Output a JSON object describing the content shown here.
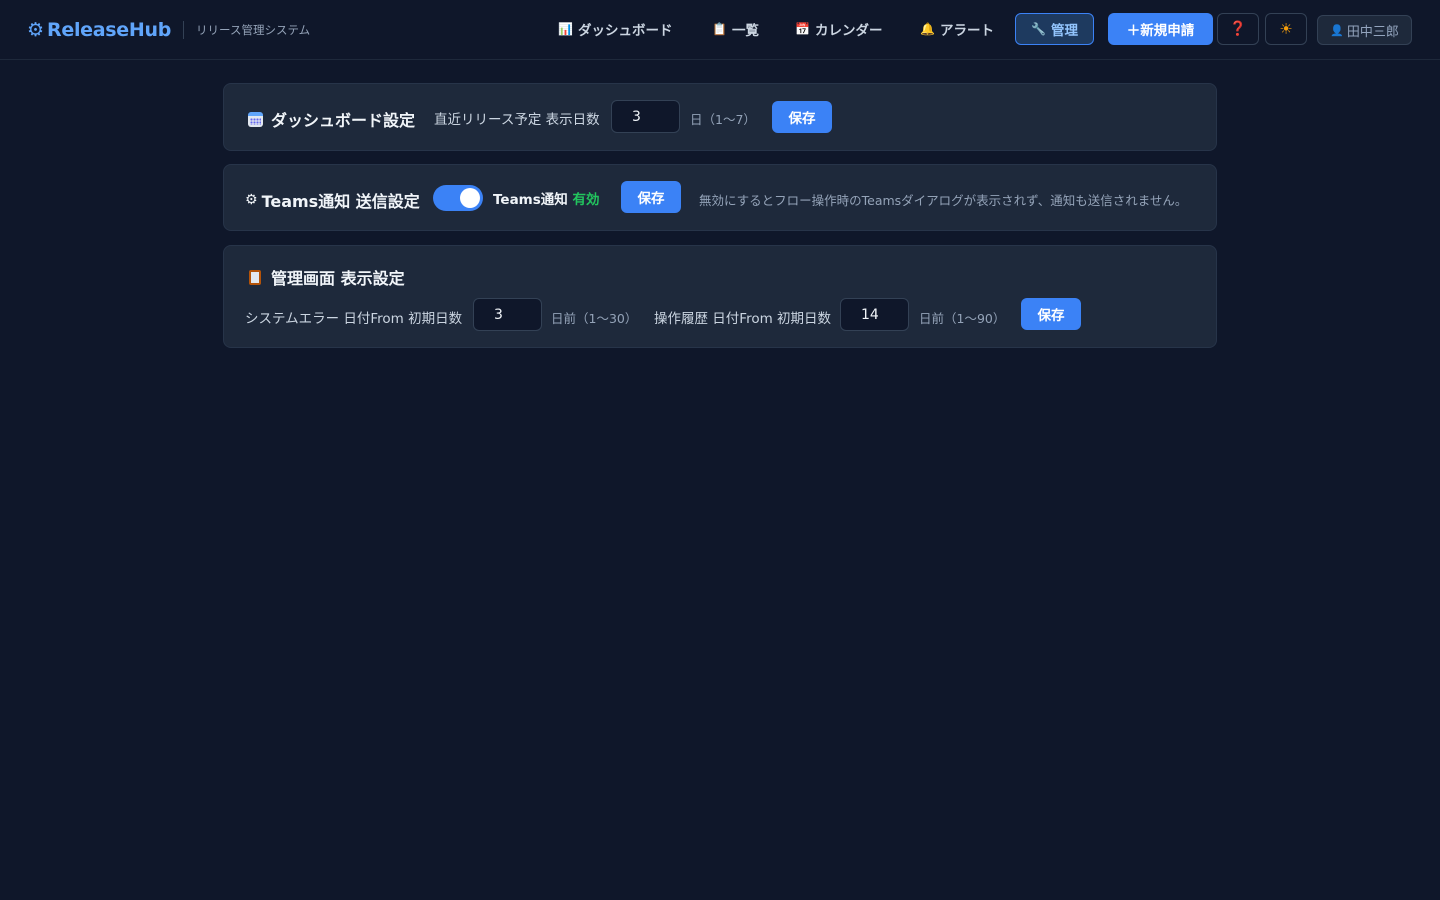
{
  "header": {
    "brand_icon": "⚙",
    "brand_name": "ReleaseHub",
    "brand_sub": "リリース管理システム",
    "nav": [
      {
        "icon": "📊",
        "label": "ダッシュボード"
      },
      {
        "icon": "📋",
        "label": "一覧"
      },
      {
        "icon": "📅",
        "label": "カレンダー"
      },
      {
        "icon": "🔔",
        "label": "アラート"
      },
      {
        "icon": "🔧",
        "label": "管理"
      }
    ],
    "new_button": "＋新規申請",
    "help_icon": "❓",
    "theme_icon": "☀",
    "user_icon": "👤",
    "user_name": "田中三郎"
  },
  "dashboard_settings": {
    "title": "ダッシュボード設定",
    "label": "直近リリース予定 表示日数",
    "value": "3",
    "hint": "日（1〜7）",
    "save": "保存"
  },
  "teams_settings": {
    "icon": "⚙",
    "title": "Teams通知 送信設定",
    "toggle_on": true,
    "toggle_label": "Teams通知",
    "status": "有効",
    "save": "保存",
    "note": "無効にするとフロー操作時のTeamsダイアログが表示されず、通知も送信されません。"
  },
  "admin_settings": {
    "title": "管理画面 表示設定",
    "error_label": "システムエラー 日付From 初期日数",
    "error_value": "3",
    "error_hint": "日前（1〜30）",
    "history_label": "操作履歴 日付From 初期日数",
    "history_value": "14",
    "history_hint": "日前（1〜90）",
    "save": "保存"
  },
  "colors": {
    "background": "#0f172a",
    "card": "#1e293b",
    "accent": "#3b82f6",
    "success": "#22c55e"
  }
}
